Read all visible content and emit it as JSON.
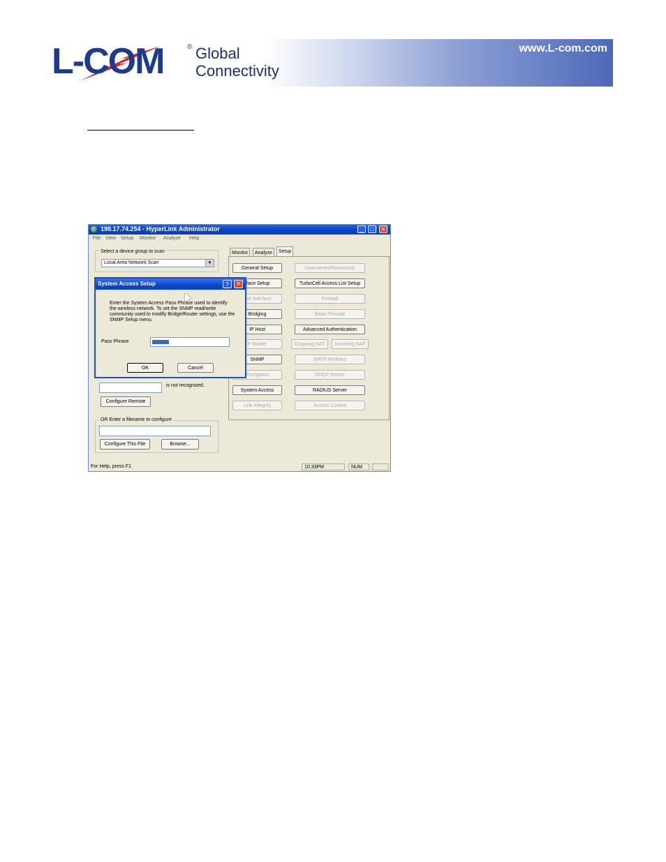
{
  "header": {
    "logo_text": "L-COM",
    "registered_mark": "®",
    "tagline_line1": "Global",
    "tagline_line2": "Connectivity",
    "url": "www.L-com.com"
  },
  "window": {
    "title": "198.17.74.254 - HyperLink Administrator",
    "menu": [
      "File",
      "View",
      "Setup",
      "Monitor",
      "Analyze",
      "Help"
    ],
    "left": {
      "device_group_label": "Select a device group to scan",
      "device_group_value": "Local Area Network Scan",
      "not_recognized_text": "is not recognized.",
      "configure_remote": "Configure Remote",
      "filename_label": "OR Enter a filename to configure",
      "configure_file": "Configure This File",
      "browse": "Browse..."
    },
    "tabs": [
      "Monitor",
      "Analyze",
      "Setup"
    ],
    "setup_buttons": {
      "col1": [
        "General Setup",
        "rface Setup",
        "ced Interface",
        "Bridging",
        "IP Host",
        "P Router",
        "SNMP",
        "Encryption",
        "System Access",
        "Link Integrity"
      ],
      "col2": [
        "Usernames/Passwords",
        "TurboCell Access List Setup",
        "Firewall",
        "Basic Firewall",
        "Advanced Authentication",
        "SMTP Redirect",
        "DHCP Server",
        "RADIUS Server",
        "Access Control"
      ],
      "nat_outgoing": "Outgoing NAT",
      "nat_incoming": "Incoming NAT"
    },
    "status": {
      "help": "For Help, press F1",
      "time": "10:33PM",
      "num": "NUM"
    }
  },
  "dialog": {
    "title": "System Access Setup",
    "help_glyph": "?",
    "close_glyph": "✕",
    "instructions": "Enter the System Access Pass Phrase used to identify the wireless network. To set the SNMP read/write community used to modify Bridge/Router settings, use the SNMP Setup menu.",
    "pass_label": "Pass Phrase",
    "ok": "OK",
    "cancel": "Cancel"
  },
  "colors": {
    "brand_blue": "#1d3a8c",
    "xp_title_blue": "#0a45c9",
    "window_face": "#ece9d8"
  }
}
